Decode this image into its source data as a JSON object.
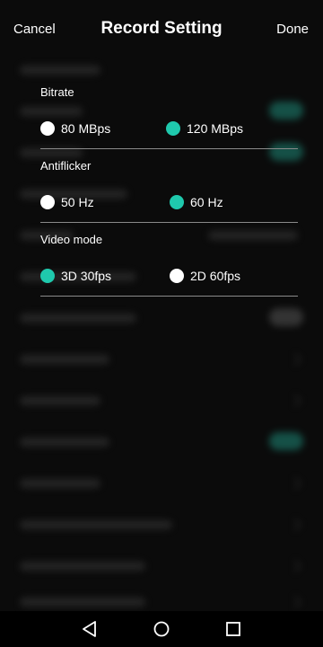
{
  "header": {
    "cancel_label": "Cancel",
    "title": "Record Setting",
    "done_label": "Done"
  },
  "sections": [
    {
      "label": "Bitrate",
      "options": [
        {
          "label": "80 MBps",
          "selected": false
        },
        {
          "label": "120 MBps",
          "selected": true
        }
      ]
    },
    {
      "label": "Antiflicker",
      "options": [
        {
          "label": "50 Hz",
          "selected": false
        },
        {
          "label": "60 Hz",
          "selected": true
        }
      ]
    },
    {
      "label": "Video mode",
      "options": [
        {
          "label": "3D 30fps",
          "selected": true
        },
        {
          "label": "2D 60fps",
          "selected": false
        }
      ]
    }
  ],
  "navbar": {
    "icons": [
      "back-icon",
      "home-icon",
      "recents-icon"
    ]
  },
  "colors": {
    "accent": "#1fc9ad",
    "background": "#0b0b0b",
    "radio_unselected": "#ffffff",
    "divider": "#8a8a8a"
  }
}
